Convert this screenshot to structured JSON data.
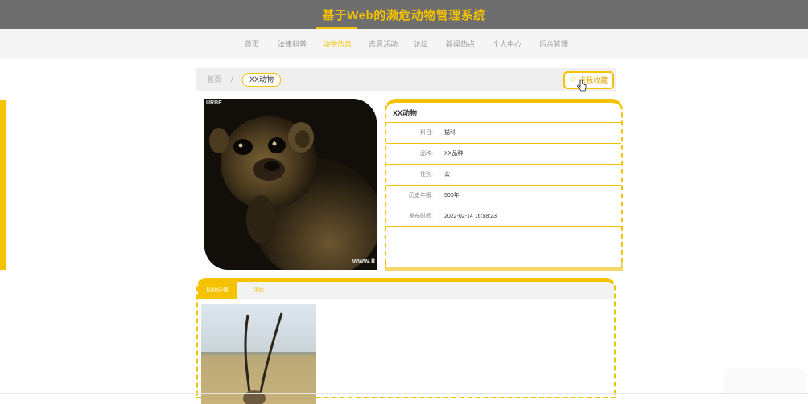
{
  "header": {
    "title": "基于Web的濒危动物管理系统"
  },
  "nav": {
    "items": [
      {
        "label": "首页",
        "active": false
      },
      {
        "label": "法律科普",
        "active": false
      },
      {
        "label": "动物信息",
        "active": true
      },
      {
        "label": "志愿活动",
        "active": false
      },
      {
        "label": "论坛",
        "active": false
      },
      {
        "label": "新闻热点",
        "active": false
      },
      {
        "label": "个人中心",
        "active": false
      },
      {
        "label": "后台管理",
        "active": false
      }
    ]
  },
  "breadcrumb": {
    "home": "首页",
    "separator": "/",
    "current": "XX动物"
  },
  "actions": {
    "favorite": "点我收藏",
    "favorite_icon": "star-icon"
  },
  "photo": {
    "watermark_top": "URBE",
    "watermark_bottom": "www.il"
  },
  "info": {
    "title": "XX动物",
    "rows": [
      {
        "label": "科目:",
        "value": "猫科"
      },
      {
        "label": "品种:",
        "value": "XX品种"
      },
      {
        "label": "性别:",
        "value": "公"
      },
      {
        "label": "历史年限:",
        "value": "500年"
      },
      {
        "label": "发布时间:",
        "value": "2022-02-14 16:58:23"
      }
    ]
  },
  "detail": {
    "tabs": [
      {
        "label": "动物详情",
        "active": true
      },
      {
        "label": "评论",
        "active": false
      }
    ]
  },
  "colors": {
    "accent": "#f5c200",
    "topbar": "#6e6e6e",
    "nav_bg": "#f5f5f5"
  }
}
